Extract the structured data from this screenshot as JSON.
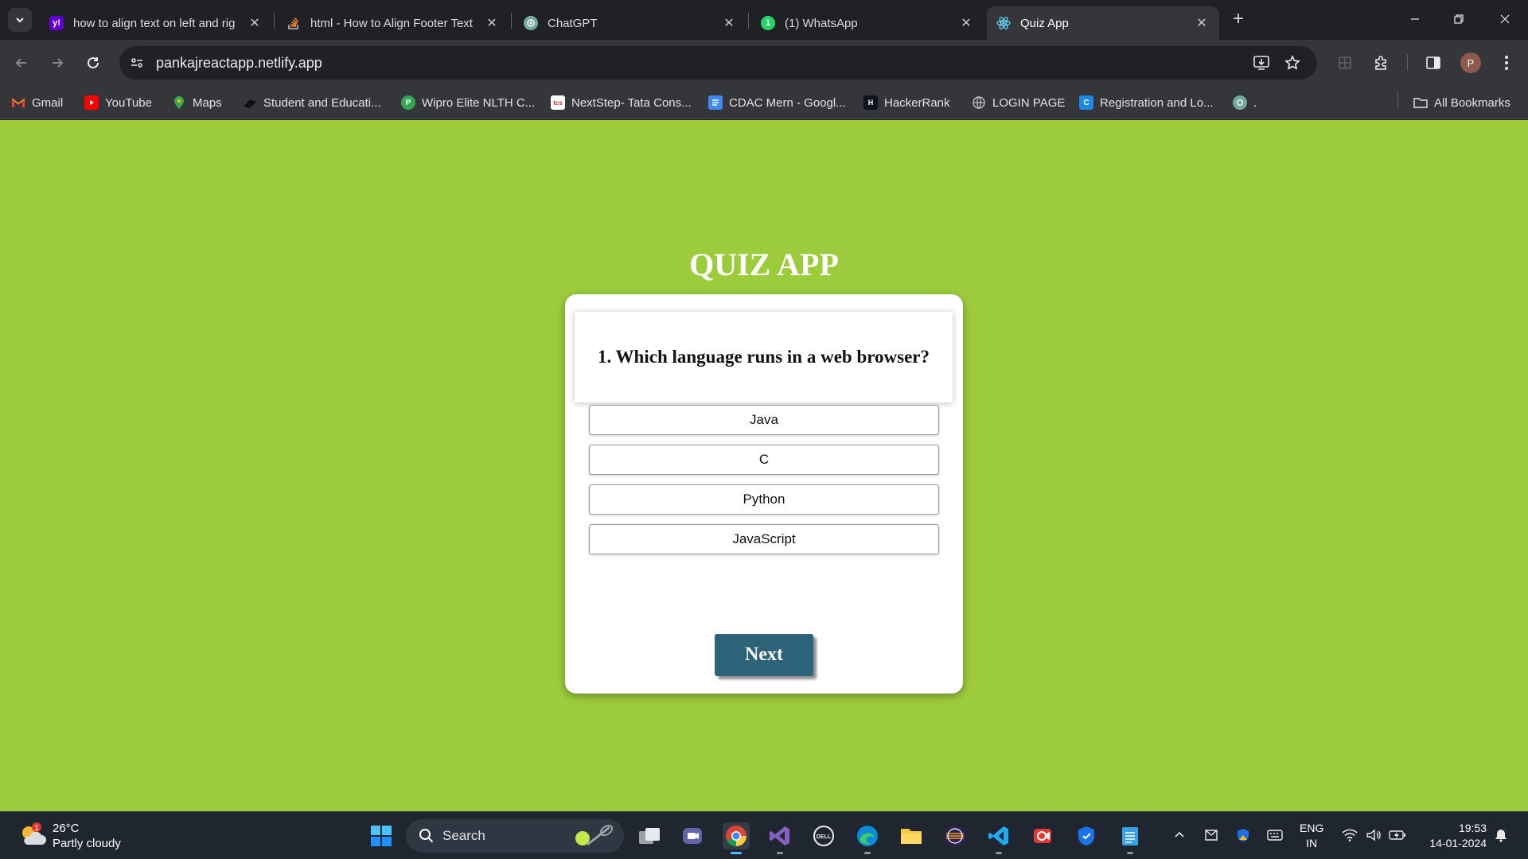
{
  "browser": {
    "tabs": [
      {
        "title": "how to align text on left and rig",
        "favicon": "yahoo-icon",
        "active": false
      },
      {
        "title": "html - How to Align Footer Text",
        "favicon": "stackoverflow-icon",
        "active": false
      },
      {
        "title": "ChatGPT",
        "favicon": "chatgpt-icon",
        "active": false
      },
      {
        "title": "(1) WhatsApp",
        "favicon": "whatsapp-icon",
        "active": false
      },
      {
        "title": "Quiz App",
        "favicon": "react-icon",
        "active": true
      }
    ],
    "address_bar": {
      "url": "pankajreactapp.netlify.app"
    },
    "profile_initial": "P",
    "bookmarks": [
      {
        "label": "Gmail",
        "icon": "gmail-icon"
      },
      {
        "label": "YouTube",
        "icon": "youtube-icon"
      },
      {
        "label": "Maps",
        "icon": "maps-icon"
      },
      {
        "label": "Student and Educati...",
        "icon": "student-icon"
      },
      {
        "label": "Wipro Elite NLTH C...",
        "icon": "wipro-icon"
      },
      {
        "label": "NextStep- Tata Cons...",
        "icon": "tcs-icon"
      },
      {
        "label": "CDAC Mern - Googl...",
        "icon": "docs-icon"
      },
      {
        "label": "HackerRank",
        "icon": "hackerrank-icon"
      },
      {
        "label": "LOGIN PAGE",
        "icon": "globe-icon"
      },
      {
        "label": "Registration and Lo...",
        "icon": "registration-icon"
      },
      {
        "label": ".",
        "icon": "chatgpt-icon"
      }
    ],
    "all_bookmarks_label": "All Bookmarks"
  },
  "quiz": {
    "title": "QUIZ APP",
    "question": "1. Which language runs in a web browser?",
    "options": [
      "Java",
      "C",
      "Python",
      "JavaScript"
    ],
    "next_label": "Next"
  },
  "taskbar": {
    "weather": {
      "temp": "26°C",
      "condition": "Partly cloudy",
      "badge": "1"
    },
    "search_label": "Search",
    "language": {
      "line1": "ENG",
      "line2": "IN"
    },
    "clock": {
      "time": "19:53",
      "date": "14-01-2024"
    }
  },
  "colors": {
    "page_background": "#9ccc3c",
    "next_button": "#2d6378",
    "browser_frame": "#202124",
    "toolbar": "#35363a"
  }
}
